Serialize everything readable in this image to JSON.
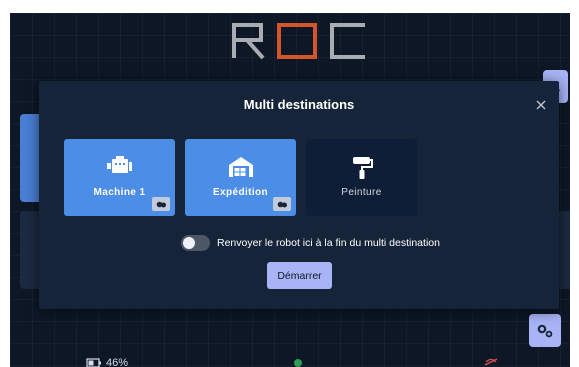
{
  "app": {
    "logo_text": "ROC"
  },
  "modal": {
    "title": "Multi destinations",
    "close_icon": "close-icon",
    "destinations": [
      {
        "label": "Machine 1",
        "icon": "engine-icon",
        "selected": true,
        "badge_icon": "robot-badge-icon"
      },
      {
        "label": "Expédition",
        "icon": "warehouse-icon",
        "selected": true,
        "badge_icon": "robot-badge-icon"
      },
      {
        "label": "Peinture",
        "icon": "paint-roller-icon",
        "selected": false
      }
    ],
    "return_toggle": {
      "label": "Renvoyer le robot ici à la fin du multi destination",
      "on": false
    },
    "start_label": "Démarrer"
  },
  "status_bar": {
    "battery": "46%"
  },
  "colors": {
    "accent": "#4c8de6",
    "button": "#a9b4f7",
    "background": "#0d1726",
    "logo_accent": "#d3542d"
  }
}
